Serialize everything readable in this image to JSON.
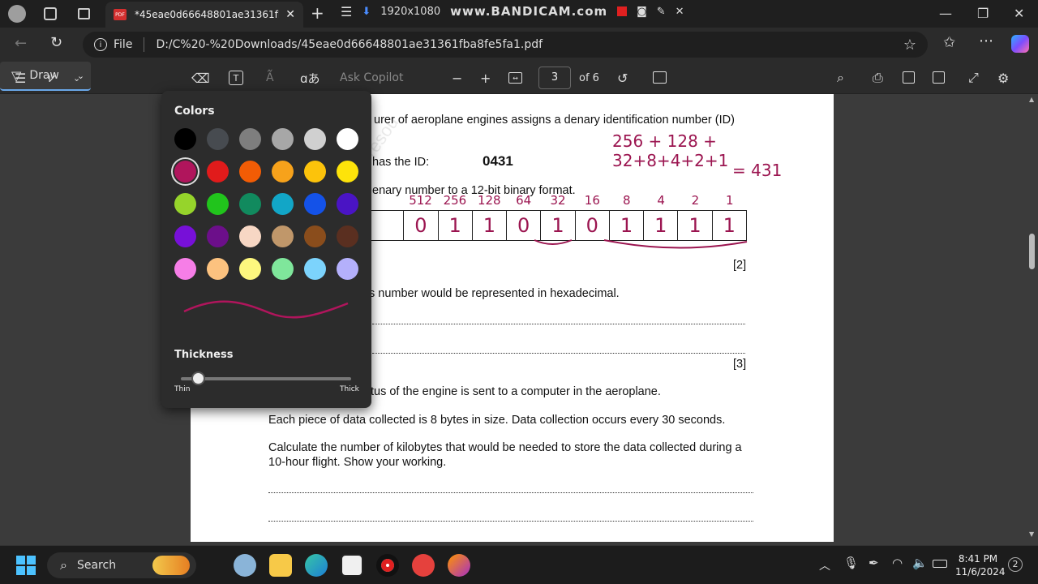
{
  "browser": {
    "tab_title": "*45eae0d66648801ae31361fba8fe5fa1.pdf",
    "tab_pdf_label": "PDF",
    "recording_resolution": "1920x1080",
    "recording_brand": "www.BANDICAM.com",
    "address_prefix": "File",
    "address_url": "D:/C%20-%20Downloads/45eae0d66648801ae31361fba8fe5fa1.pdf"
  },
  "pdf_toolbar": {
    "draw_label": "Draw",
    "ask_copilot": "Ask Copilot",
    "page_number": "3",
    "page_total": "of 6"
  },
  "draw_popup": {
    "colors_title": "Colors",
    "thickness_title": "Thickness",
    "thin_label": "Thin",
    "thick_label": "Thick",
    "thickness_value": 0.05,
    "selected_color": "#b0155c",
    "palette": [
      [
        "#000000",
        "#474b50",
        "#7e7e7e",
        "#a7a7a7",
        "#d0d0d0",
        "#ffffff"
      ],
      [
        "#b0155c",
        "#e11b1b",
        "#f25c05",
        "#f7a21b",
        "#fcc30b",
        "#fde30a"
      ],
      [
        "#96d42b",
        "#21c41c",
        "#118a5e",
        "#12a6c7",
        "#1452e8",
        "#4a14c4"
      ],
      [
        "#7710d8",
        "#6c0f8a",
        "#f7d7c4",
        "#c0976a",
        "#8a4d1c",
        "#5a2f20"
      ],
      [
        "#f67ee7",
        "#fcc27f",
        "#fdf77e",
        "#7fe69b",
        "#7cd3fc",
        "#b4b0fb"
      ]
    ]
  },
  "document": {
    "line1": "urer of aeroplane engines assigns a denary identification number (ID)",
    "line2_prefix": "has the ID:",
    "id_value": "0431",
    "line3": "enary number to a 12-bit binary format.",
    "marks_2": "[2]",
    "line4": "s number would be represented in hexadecimal.",
    "marks_3": "[3]",
    "line5": "tus of the engine is sent to a computer in the aeroplane.",
    "line6": "Each piece of data collected is 8 bytes in size. Data collection occurs every 30 seconds.",
    "line7a": "Calculate the number of kilobytes that would be needed to store the data collected during a",
    "line7b": "10-hour flight. Show your working.",
    "watermark": "resou",
    "binary_cells": [
      "",
      "0",
      "1",
      "1",
      "0",
      "1",
      "0",
      "1",
      "1",
      "1",
      "1"
    ],
    "place_values": [
      "512",
      "256",
      "128",
      "64",
      "32",
      "16",
      "8",
      "4",
      "2",
      "1"
    ],
    "annotation_sum": "256 + 128 + 32+8+4+2+1",
    "annotation_result": "= 431"
  },
  "taskbar": {
    "search_label": "Search",
    "time": "8:41 PM",
    "date": "11/6/2024",
    "notification_count": "2"
  }
}
